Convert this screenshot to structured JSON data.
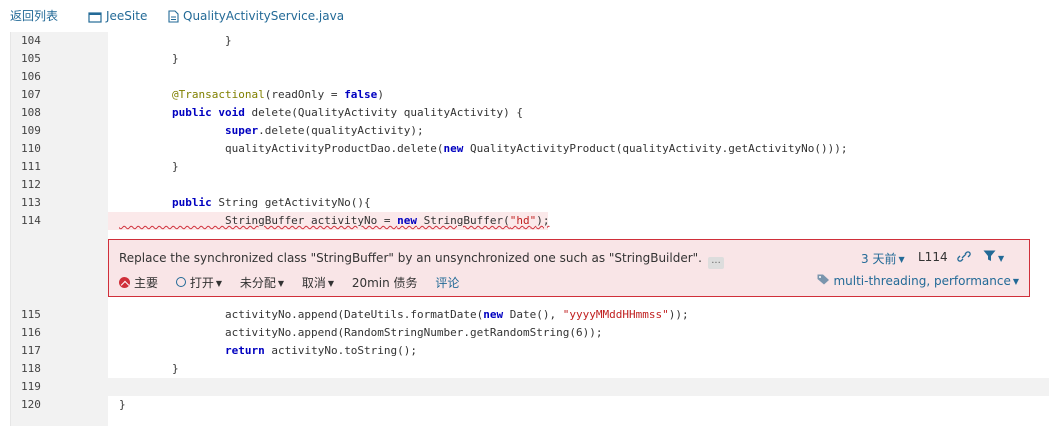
{
  "topbar": {
    "back_label": "返回列表",
    "project_label": "JeeSite",
    "file_label": "QualityActivityService.java"
  },
  "lines": [
    {
      "num": "104",
      "code": "                }"
    },
    {
      "num": "105",
      "code": "        }"
    },
    {
      "num": "106",
      "code": ""
    },
    {
      "num": "107",
      "code": "        @Transactional(readOnly = false)"
    },
    {
      "num": "108",
      "code": "        public void delete(QualityActivity qualityActivity) {"
    },
    {
      "num": "109",
      "code": "                super.delete(qualityActivity);"
    },
    {
      "num": "110",
      "code": "                qualityActivityProductDao.delete(new QualityActivityProduct(qualityActivity.getActivityNo()));"
    },
    {
      "num": "111",
      "code": "        }"
    },
    {
      "num": "112",
      "code": ""
    },
    {
      "num": "113",
      "code": "        public String getActivityNo(){"
    },
    {
      "num": "114",
      "code": "                StringBuffer activityNo = new StringBuffer(\"hd\");"
    },
    {
      "num": "115",
      "code": "                activityNo.append(DateUtils.formatDate(new Date(), \"yyyyMMddHHmmss\"));"
    },
    {
      "num": "116",
      "code": "                activityNo.append(RandomStringNumber.getRandomString(6));"
    },
    {
      "num": "117",
      "code": "                return activityNo.toString();"
    },
    {
      "num": "118",
      "code": "        }"
    },
    {
      "num": "119",
      "code": ""
    },
    {
      "num": "120",
      "code": "}"
    }
  ],
  "issue": {
    "message": "Replace the synchronized class \"StringBuffer\" by an unsynchronized one such as \"StringBuilder\".",
    "more_label": "...",
    "age": "3 天前",
    "line_ref": "L114",
    "severity": "主要",
    "status": "打开",
    "assignee": "未分配",
    "resolution": "取消",
    "effort": "20min 债务",
    "comment": "评论",
    "tags": "multi-threading, performance"
  },
  "colors": {
    "accent": "#236a97",
    "error": "#d02f3a",
    "issue_bg": "#f9e5e7"
  }
}
